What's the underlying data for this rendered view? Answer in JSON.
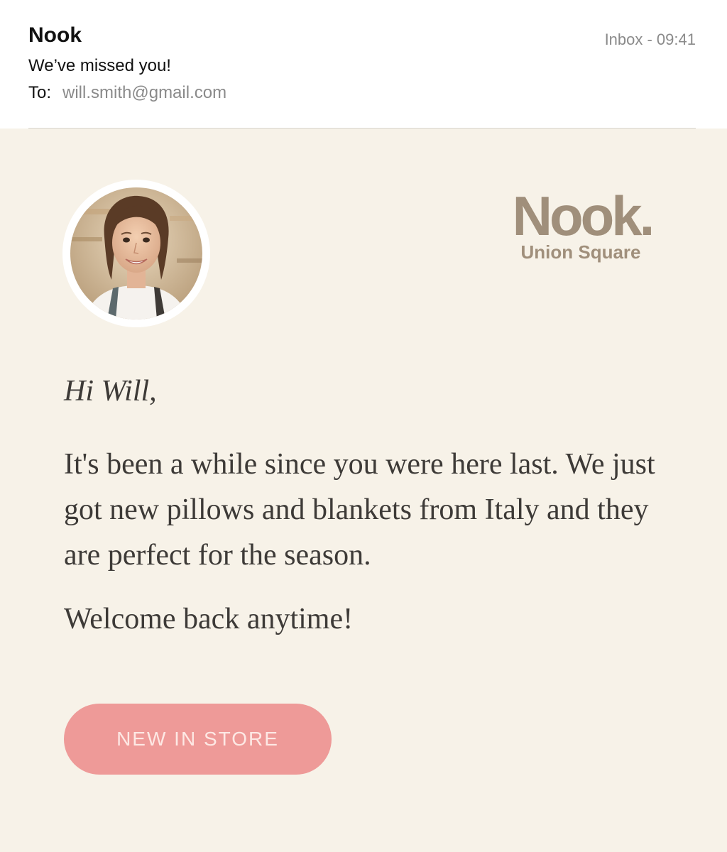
{
  "email": {
    "sender": "Nook",
    "meta": "Inbox - 09:41",
    "subject": "We’ve missed you!",
    "to_label": "To:",
    "to_address": "will.smith@gmail.com"
  },
  "brand": {
    "name": "Nook.",
    "location": "Union Square",
    "color": "#a08f7b"
  },
  "message": {
    "greeting": "Hi Will,",
    "body": "It's been a while since you were here last. We just got new pillows and blankets from Italy and they are perfect for the season.",
    "closing": "Welcome back anytime!"
  },
  "cta": {
    "label": "NEW IN STORE",
    "color": "#ee9a98"
  },
  "colors": {
    "background": "#f7f2e8",
    "text": "#3d3a37"
  },
  "avatar": {
    "icon": "person-photo"
  }
}
